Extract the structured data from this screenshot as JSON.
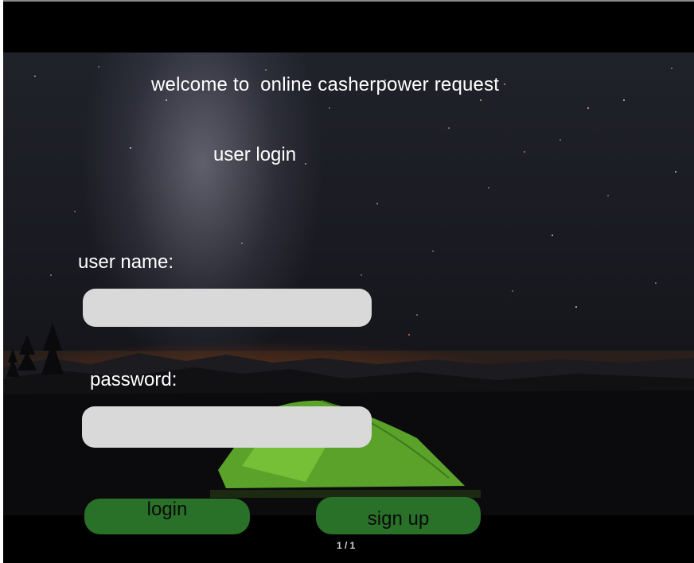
{
  "header": {
    "title": "welcome to  online casherpower request",
    "subtitle": "user login"
  },
  "form": {
    "username_label": "user name:",
    "username_value": "",
    "password_label": "password:",
    "password_value": ""
  },
  "actions": {
    "login_label": "login",
    "signup_label": "sign up"
  },
  "footer": {
    "page_indicator": "1 / 1"
  },
  "colors": {
    "button_green": "#297028",
    "field_gray": "#d9d9d9",
    "text_white": "#ffffff"
  }
}
